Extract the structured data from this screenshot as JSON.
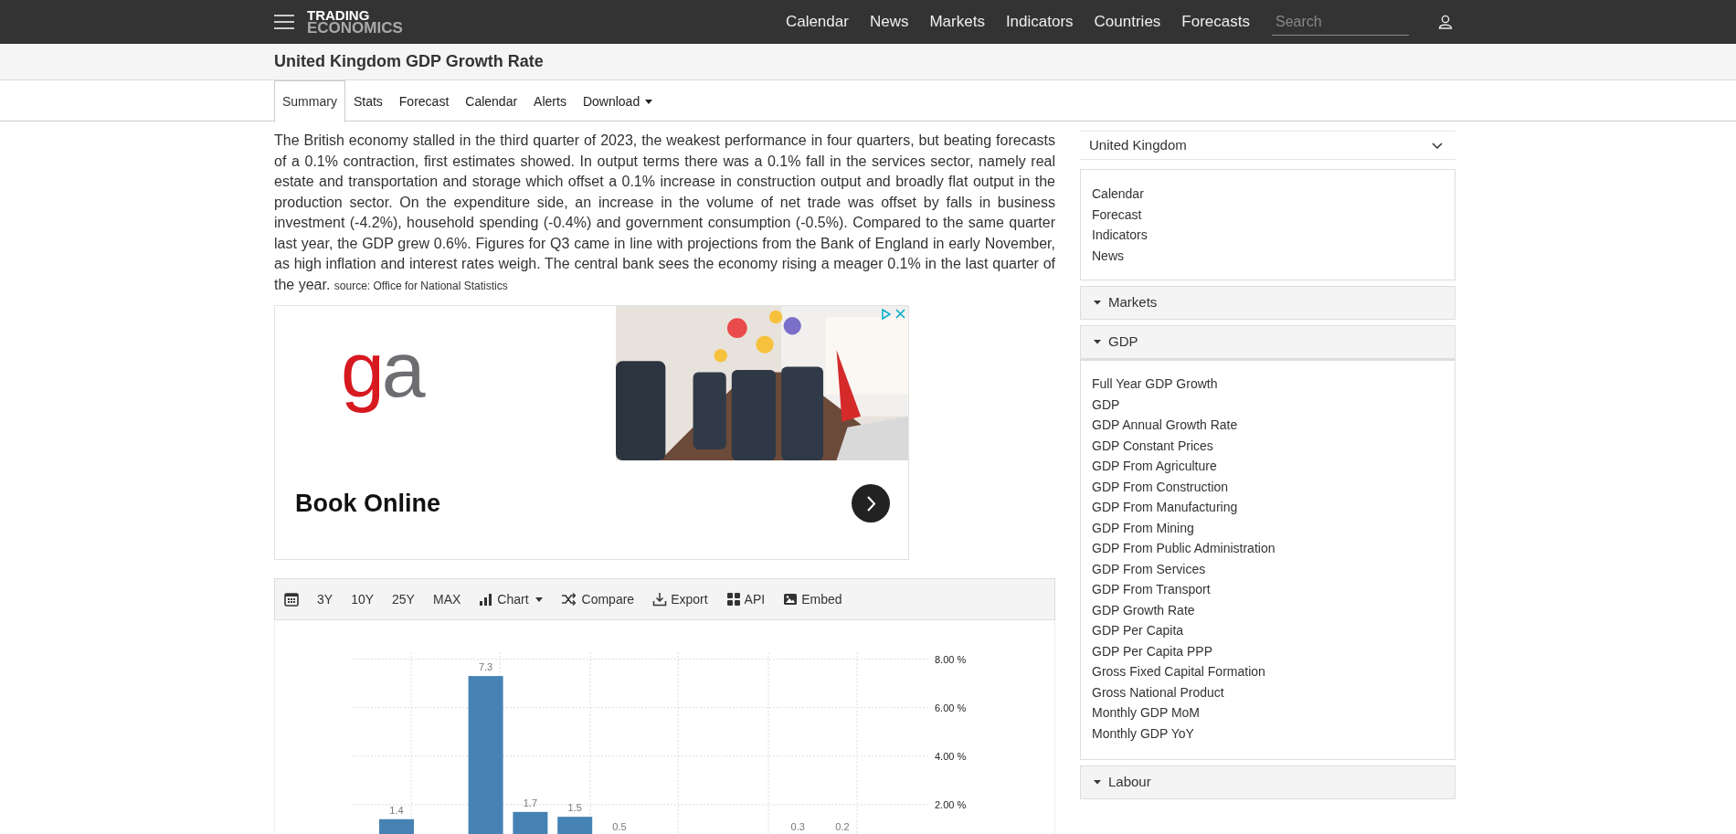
{
  "header": {
    "logo": {
      "line_1": "TRADING",
      "line_2": "ECONOMICS"
    },
    "nav": [
      "Calendar",
      "News",
      "Markets",
      "Indicators",
      "Countries",
      "Forecasts"
    ],
    "search": {
      "placeholder": "Search"
    }
  },
  "page_title": "United Kingdom GDP Growth Rate",
  "tabs": [
    {
      "label": "Summary",
      "selected": true,
      "dropdown": false
    },
    {
      "label": "Stats",
      "selected": false,
      "dropdown": false
    },
    {
      "label": "Forecast",
      "selected": false,
      "dropdown": false
    },
    {
      "label": "Calendar",
      "selected": false,
      "dropdown": false
    },
    {
      "label": "Alerts",
      "selected": false,
      "dropdown": false
    },
    {
      "label": "Download",
      "selected": false,
      "dropdown": true
    }
  ],
  "summary": {
    "text": "The British economy stalled in the third quarter of 2023, the weakest performance in four quarters, but beating forecasts of a 0.1% contraction, first estimates showed. In output terms there was a 0.1% fall in the services sector, namely real estate and transportation and storage which offset a 0.1% increase in construction output and broadly flat output in the production sector. On the expenditure side, an increase in the volume of net trade was offset by falls in business investment (-4.2%), household spending (-0.4%) and government consumption (-0.5%). Compared to the same quarter last year, the GDP grew 0.6%. Figures for Q3 came in line with projections from the Bank of England in early November, as high inflation and interest rates weigh. The central bank sees the economy rising a meager 0.1% in the last quarter of the year.",
    "source": "source: Office for National Statistics"
  },
  "ad": {
    "logo": "ga",
    "headline": "Book Online"
  },
  "chart": {
    "toolbar": [
      {
        "kind": "calendar"
      },
      {
        "kind": "range",
        "label": "3Y"
      },
      {
        "kind": "range",
        "label": "10Y"
      },
      {
        "kind": "range",
        "label": "25Y"
      },
      {
        "kind": "range",
        "label": "MAX"
      },
      {
        "kind": "chart",
        "label": "Chart"
      },
      {
        "kind": "compare",
        "label": "Compare"
      },
      {
        "kind": "export",
        "label": "Export"
      },
      {
        "kind": "api",
        "label": "API"
      },
      {
        "kind": "embed",
        "label": "Embed"
      }
    ],
    "chart_data": {
      "type": "bar",
      "values": [
        1.4,
        null,
        7.3,
        1.7,
        1.5,
        null,
        null,
        null,
        null,
        null,
        null
      ],
      "value_labels": [
        "1.4",
        null,
        "7.3",
        "1.7",
        "1.5",
        "0.5",
        null,
        null,
        null,
        "0.3",
        "0.2"
      ],
      "ylim": [
        0,
        8
      ],
      "grid": true,
      "yticks": [
        {
          "value": 2,
          "label": "2.00 %"
        },
        {
          "value": 4,
          "label": "4.00 %"
        },
        {
          "value": 6,
          "label": "6.00 %"
        },
        {
          "value": 8,
          "label": "8.00 %"
        }
      ]
    }
  },
  "sidebar": {
    "country": "United Kingdom",
    "links": [
      "Calendar",
      "Forecast",
      "Indicators",
      "News"
    ],
    "sections": [
      {
        "label": "Markets"
      },
      {
        "label": "GDP",
        "items": [
          "Full Year GDP Growth",
          "GDP",
          "GDP Annual Growth Rate",
          "GDP Constant Prices",
          "GDP From Agriculture",
          "GDP From Construction",
          "GDP From Manufacturing",
          "GDP From Mining",
          "GDP From Public Administration",
          "GDP From Services",
          "GDP From Transport",
          "GDP Growth Rate",
          "GDP Per Capita",
          "GDP Per Capita PPP",
          "Gross Fixed Capital Formation",
          "Gross National Product",
          "Monthly GDP MoM",
          "Monthly GDP YoY"
        ]
      },
      {
        "label": "Labour"
      }
    ]
  }
}
